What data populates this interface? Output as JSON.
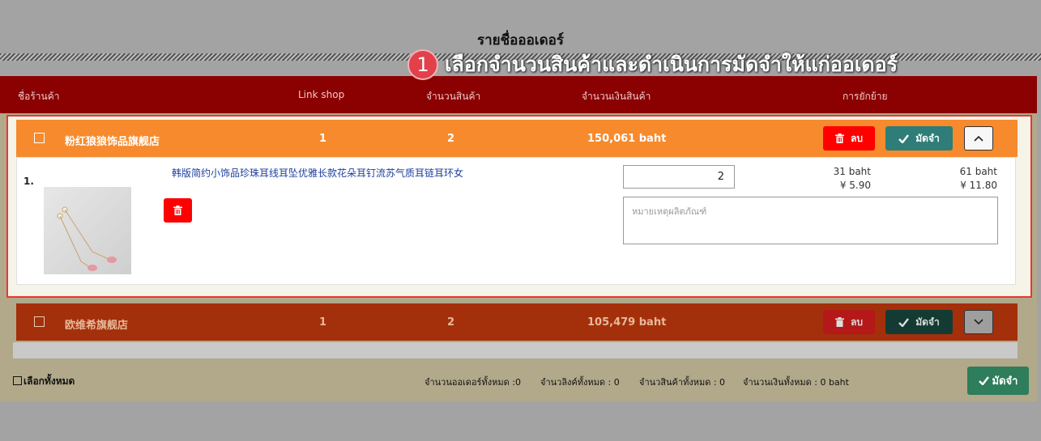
{
  "page": {
    "title": "รายชื่อออเดอร์"
  },
  "callout": {
    "number": "1",
    "text": "เลือกจำนวนสินค้าและดำเนินการมัดจำให้แก่ออเดอร์"
  },
  "table_header": {
    "shop_name": "ชื่อร้านค้า",
    "link_shop": "Link shop",
    "qty": "จำนวนสินค้า",
    "amount": "จำนวนเงินสินค้า",
    "actions": "การยักย้าย"
  },
  "shops": [
    {
      "name": "粉红狼狼饰品旗舰店",
      "link_count": "1",
      "qty": "2",
      "amount": "150,061 baht",
      "delete_label": "ลบ",
      "deposit_label": "มัดจำ",
      "items": [
        {
          "index": "1.",
          "name": "韩版简约小饰品珍珠耳线耳坠优雅长款花朵耳钉流苏气质耳链耳环女",
          "quantity": "2",
          "note_placeholder": "หมายเหตุผลิตภัณฑ์",
          "unit_baht": "31 baht",
          "unit_yuan": "¥  5.90",
          "total_baht": "61 baht",
          "total_yuan": "¥  11.80"
        }
      ]
    },
    {
      "name": "欧维希旗舰店",
      "link_count": "1",
      "qty": "2",
      "amount": "105,479 baht",
      "delete_label": "ลบ",
      "deposit_label": "มัดจำ"
    }
  ],
  "footer": {
    "select_all": "เลือกทั้งหมด",
    "total_orders": "จำนวนออเดอร์ทั้งหมด :0",
    "total_links": "จำนวลิงค์ทั้งหมด : 0",
    "total_items": "จำนวสินค้าทั้งหมด : 0",
    "total_amount": "จำนวนเงินทั้งหมด : 0 baht",
    "deposit_label": "มัดจำ"
  },
  "colors": {
    "header": "#8b0000",
    "shop_active": "#f68a2d",
    "shop_inactive": "#a3300a",
    "danger": "#ff0000",
    "deposit": "#2e7d79",
    "callout": "#e2404b"
  },
  "icons": [
    "trash-icon",
    "check-icon",
    "chevron-up-icon",
    "chevron-down-icon",
    "checkbox-icon"
  ]
}
